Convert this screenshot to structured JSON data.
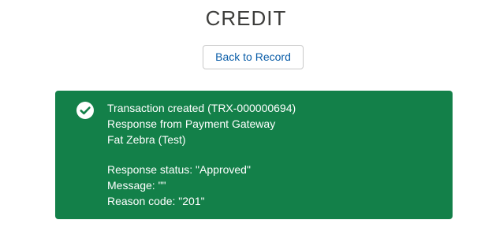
{
  "page": {
    "title": "CREDIT"
  },
  "actions": {
    "back_label": "Back to Record"
  },
  "toast": {
    "icon": "success-check-icon",
    "background": "#138049",
    "lines": [
      "Transaction created (TRX-000000694)",
      "Response from Payment Gateway",
      "Fat Zebra (Test)"
    ],
    "details": [
      "Response status: \"Approved\"",
      "Message: \"\"",
      "Reason code: \"201\""
    ]
  }
}
